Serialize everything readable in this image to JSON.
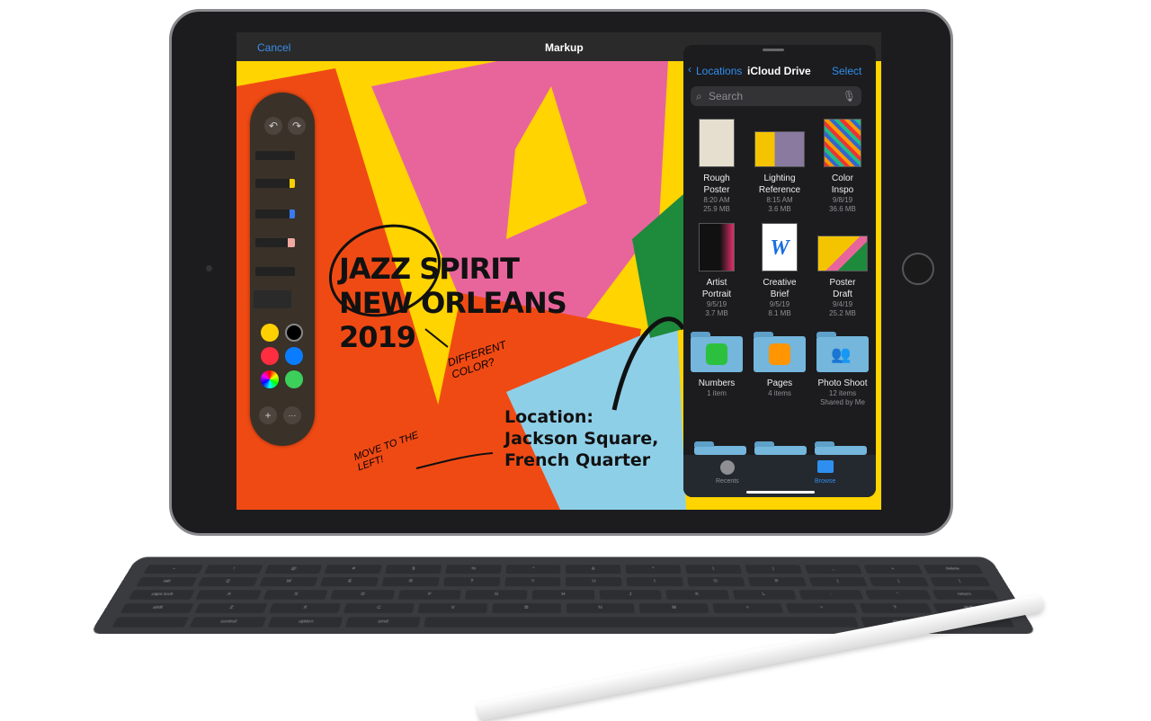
{
  "topbar": {
    "cancel": "Cancel",
    "title": "Markup"
  },
  "poster": {
    "line1": "JAZZ SPIRIT",
    "line2": "NEW ORLEANS",
    "line3": "2019",
    "location": "Location:",
    "place1": "Jackson Square,",
    "place2": "French Quarter",
    "note1": "DIFFERENT COLOR?",
    "note2": "MOVE TO THE LEFT!"
  },
  "palette": {
    "undo": "↶",
    "redo": "↷",
    "add": "+",
    "more": "···",
    "colors": [
      "#ffd000",
      "#000000",
      "#ff2d40",
      "#0a7cff",
      "#color-wheel",
      "#3ccf5a"
    ]
  },
  "browser": {
    "back": "Locations",
    "title": "iCloud Drive",
    "select": "Select",
    "search_placeholder": "Search",
    "files": [
      {
        "name1": "Rough",
        "name2": "Poster",
        "meta1": "8:20 AM",
        "meta2": "25.9 MB"
      },
      {
        "name1": "Lighting",
        "name2": "Reference",
        "meta1": "8:15 AM",
        "meta2": "3.6 MB"
      },
      {
        "name1": "Color",
        "name2": "Inspo",
        "meta1": "9/8/19",
        "meta2": "36.6 MB"
      },
      {
        "name1": "Artist",
        "name2": "Portrait",
        "meta1": "9/5/19",
        "meta2": "3.7 MB"
      },
      {
        "name1": "Creative",
        "name2": "Brief",
        "meta1": "9/5/19",
        "meta2": "8.1 MB"
      },
      {
        "name1": "Poster",
        "name2": "Draft",
        "meta1": "9/4/19",
        "meta2": "25.2 MB"
      }
    ],
    "folders": [
      {
        "name": "Numbers",
        "meta1": "1 item"
      },
      {
        "name": "Pages",
        "meta1": "4 items"
      },
      {
        "name": "Photo Shoot",
        "meta1": "12 items",
        "meta2": "Shared by Me"
      }
    ],
    "tabs": {
      "recents": "Recents",
      "browse": "Browse"
    }
  },
  "keyboard": {
    "rows": [
      [
        "~",
        "!",
        "@",
        "#",
        "$",
        "%",
        "^",
        "&",
        "*",
        "(",
        ")",
        "_",
        "+",
        "delete"
      ],
      [
        "tab",
        "Q",
        "W",
        "E",
        "R",
        "T",
        "Y",
        "U",
        "I",
        "O",
        "P",
        "{",
        "}",
        "|"
      ],
      [
        "caps lock",
        "A",
        "S",
        "D",
        "F",
        "G",
        "H",
        "J",
        "K",
        "L",
        ":",
        "\"",
        "return"
      ],
      [
        "shift",
        "Z",
        "X",
        "C",
        "V",
        "B",
        "N",
        "M",
        "<",
        ">",
        "?",
        "shift"
      ],
      [
        "",
        "control",
        "option",
        "cmd",
        " ",
        "cmd",
        "option"
      ]
    ]
  }
}
